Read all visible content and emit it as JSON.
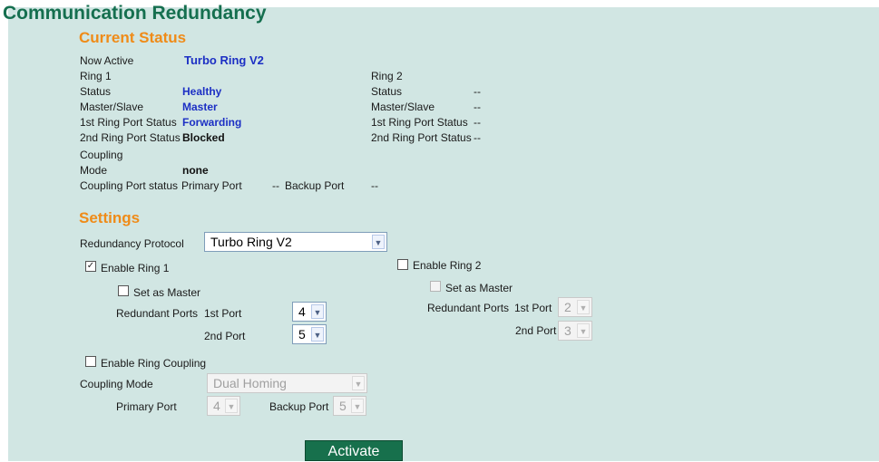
{
  "page_title": "Communication Redundancy",
  "current_status": {
    "heading": "Current Status",
    "now_active_label": "Now Active",
    "now_active_value": "Turbo Ring V2",
    "ring1": {
      "label": "Ring 1",
      "status_label": "Status",
      "status_value": "Healthy",
      "master_slave_label": "Master/Slave",
      "master_slave_value": "Master",
      "port1_label": "1st Ring Port Status",
      "port1_value": "Forwarding",
      "port2_label": "2nd Ring Port Status",
      "port2_value": "Blocked"
    },
    "ring2": {
      "label": "Ring 2",
      "status_label": "Status",
      "status_value": "--",
      "master_slave_label": "Master/Slave",
      "master_slave_value": "--",
      "port1_label": "1st Ring Port Status",
      "port1_value": "--",
      "port2_label": "2nd Ring Port Status",
      "port2_value": "--"
    },
    "coupling": {
      "label": "Coupling",
      "mode_label": "Mode",
      "mode_value": "none",
      "port_status_label": "Coupling Port status",
      "primary_port_label": "Primary Port",
      "primary_port_value": "--",
      "backup_port_label": "Backup Port",
      "backup_port_value": "--"
    }
  },
  "settings": {
    "heading": "Settings",
    "redundancy_protocol_label": "Redundancy Protocol",
    "redundancy_protocol_value": "Turbo Ring V2",
    "ring1": {
      "enable_label": "Enable Ring 1",
      "enabled": true,
      "set_master_label": "Set as Master",
      "set_master_checked": false,
      "redundant_ports_label": "Redundant Ports",
      "port1_label": "1st Port",
      "port1_value": "4",
      "port2_label": "2nd Port",
      "port2_value": "5"
    },
    "ring2": {
      "enable_label": "Enable Ring 2",
      "enabled": false,
      "set_master_label": "Set as Master",
      "redundant_ports_label": "Redundant Ports",
      "port1_label": "1st Port",
      "port1_value": "2",
      "port2_label": "2nd Port",
      "port2_value": "3"
    },
    "coupling": {
      "enable_label": "Enable Ring Coupling",
      "enabled": false,
      "mode_label": "Coupling Mode",
      "mode_value": "Dual Homing",
      "primary_port_label": "Primary Port",
      "primary_port_value": "4",
      "backup_port_label": "Backup Port",
      "backup_port_value": "5"
    }
  },
  "activate_label": "Activate",
  "colors": {
    "panel_bg": "#d1e6e3",
    "title": "#156f4f",
    "section_heading": "#ef8b18",
    "status_value": "#1c2fc4",
    "button_bg": "#17704c"
  }
}
